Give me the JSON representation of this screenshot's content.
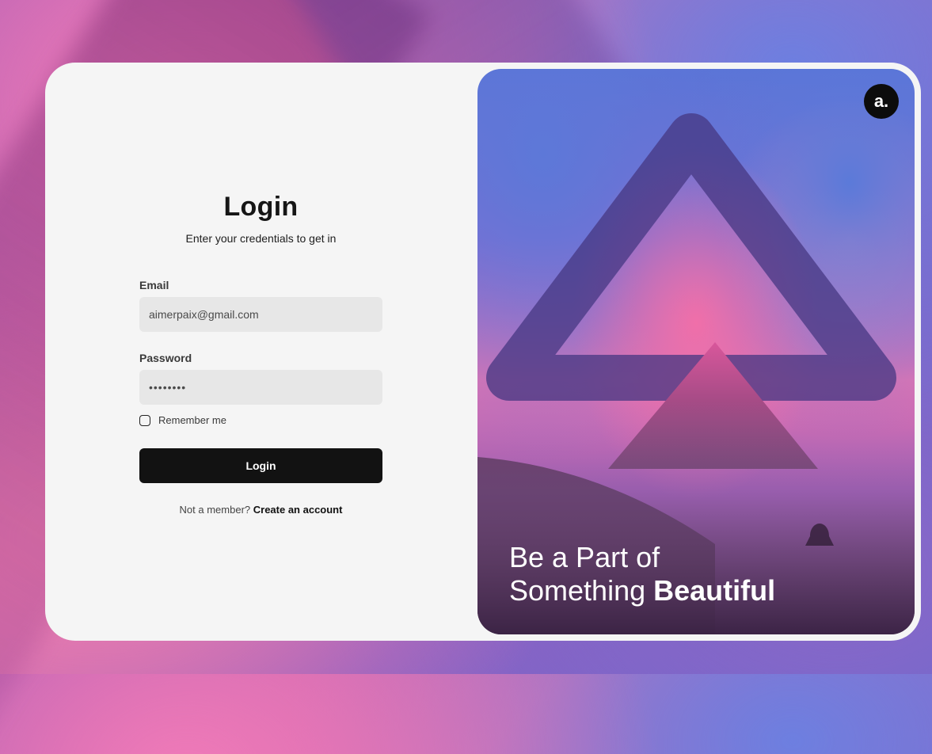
{
  "login": {
    "title": "Login",
    "subtitle": "Enter your credentials to get in",
    "email_label": "Email",
    "email_value": "aimerpaix@gmail.com",
    "password_label": "Password",
    "password_value": "••••••••",
    "remember_label": "Remember me",
    "remember_checked": false,
    "button_label": "Login",
    "signup_prompt": "Not a member?",
    "signup_link": "Create an account"
  },
  "hero": {
    "logo_text": "a.",
    "tagline_line1": "Be a Part of",
    "tagline_line2_prefix": "Something",
    "tagline_line2_bold": "Beautiful"
  },
  "colors": {
    "button_bg": "#121212",
    "card_bg": "#f5f5f5",
    "input_bg": "#e7e7e7"
  }
}
